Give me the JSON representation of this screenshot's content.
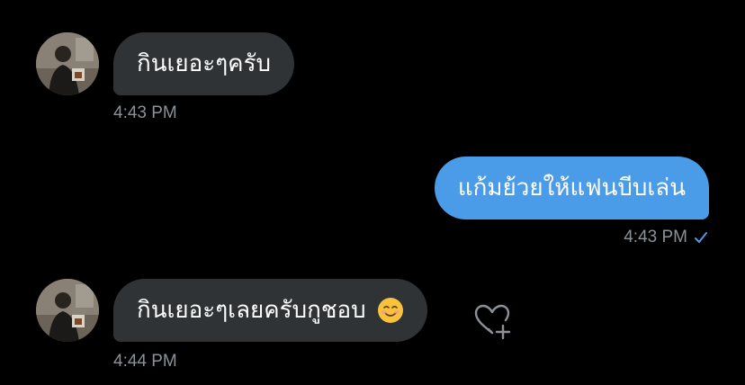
{
  "conversation": {
    "messages": [
      {
        "sender": "incoming",
        "text": "กินเยอะๆครับ",
        "time": "4:43 PM"
      },
      {
        "sender": "outgoing",
        "text": "แก้มย้วยให้แฟนบีบเล่น",
        "time": "4:43 PM",
        "status_icon": "checkmark-icon"
      },
      {
        "sender": "incoming",
        "text": "กินเยอะๆเลยครับกูชอบ",
        "emoji": "☺️",
        "time": "4:44 PM",
        "reaction_icon": "heart-add-icon"
      }
    ]
  },
  "colors": {
    "background": "#000000",
    "incoming_bubble": "#2f3336",
    "outgoing_bubble": "#4a9ce8",
    "timestamp": "#8b9197",
    "check": "#4a9ce8"
  }
}
